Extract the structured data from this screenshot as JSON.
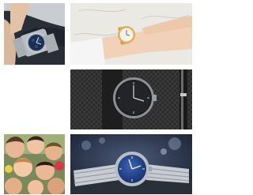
{
  "grid": {
    "tiles": [
      {
        "subject": "wrist-watch-blue-dial"
      },
      {
        "subject": "gold-watch-on-wrist"
      },
      {
        "subject": "black-dial-watch-with-pen"
      },
      {
        "subject": "blank"
      },
      {
        "subject": "group-of-people"
      },
      {
        "subject": "blue-dial-steel-watch"
      }
    ]
  },
  "colors": {
    "background": "#ffffff"
  }
}
